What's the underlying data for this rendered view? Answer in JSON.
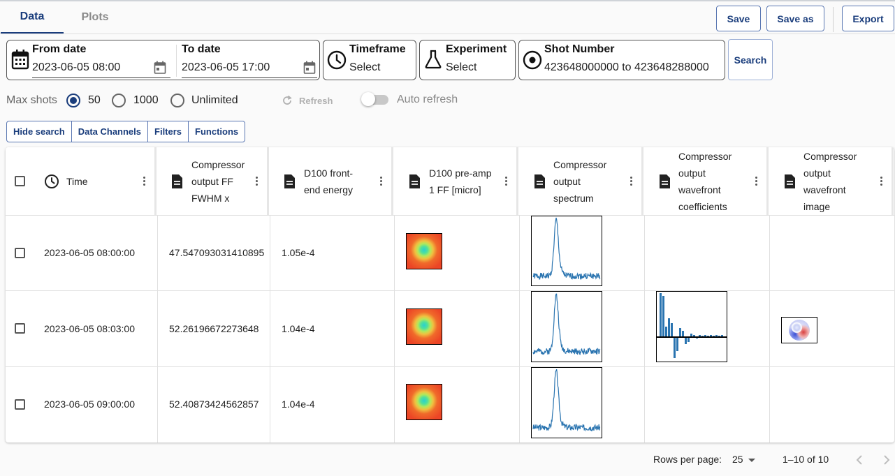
{
  "tabs": [
    {
      "label": "Data"
    },
    {
      "label": "Plots"
    }
  ],
  "toolbar": {
    "save": "Save",
    "save_as": "Save as",
    "export": "Export"
  },
  "filters": {
    "from_date": {
      "label": "From date",
      "value": "2023-06-05 08:00"
    },
    "to_date": {
      "label": "To date",
      "value": "2023-06-05 17:00"
    },
    "timeframe": {
      "label": "Timeframe",
      "value": "Select"
    },
    "experiment": {
      "label": "Experiment",
      "value": "Select"
    },
    "shot_number": {
      "label": "Shot Number",
      "value": "423648000000 to 423648288000"
    },
    "search": "Search"
  },
  "max_shots": {
    "label": "Max shots",
    "options": [
      "50",
      "1000",
      "Unlimited"
    ],
    "selected": "50"
  },
  "refresh": "Refresh",
  "auto_refresh": "Auto refresh",
  "button_group": [
    "Hide search",
    "Data Channels",
    "Filters",
    "Functions"
  ],
  "table": {
    "columns": [
      {
        "lines": [
          "Time"
        ]
      },
      {
        "lines": [
          "Compressor",
          "output FF",
          "FWHM x"
        ]
      },
      {
        "lines": [
          "D100 front-",
          "end energy"
        ]
      },
      {
        "lines": [
          "D100 pre-amp",
          "1 FF [micro]"
        ]
      },
      {
        "lines": [
          "Compressor",
          "output",
          "spectrum"
        ]
      },
      {
        "lines": [
          "Compressor",
          "output",
          "wavefront",
          "coefficients"
        ]
      },
      {
        "lines": [
          "Compressor",
          "output",
          "wavefront",
          "image"
        ]
      }
    ],
    "rows": [
      {
        "time": "2023-06-05 08:00:00",
        "fwhm": "47.547093031410895",
        "energy": "1.05e-4"
      },
      {
        "time": "2023-06-05 08:03:00",
        "fwhm": "52.26196672273648",
        "energy": "1.04e-4"
      },
      {
        "time": "2023-06-05 09:00:00",
        "fwhm": "52.40873424562857",
        "energy": "1.04e-4"
      }
    ]
  },
  "pagination": {
    "rows_per_page_label": "Rows per page:",
    "rows_per_page": "25",
    "range": "1–10 of 10"
  },
  "colors": {
    "accent": "#1a3d7c",
    "spectrum": "#2a74b0"
  }
}
